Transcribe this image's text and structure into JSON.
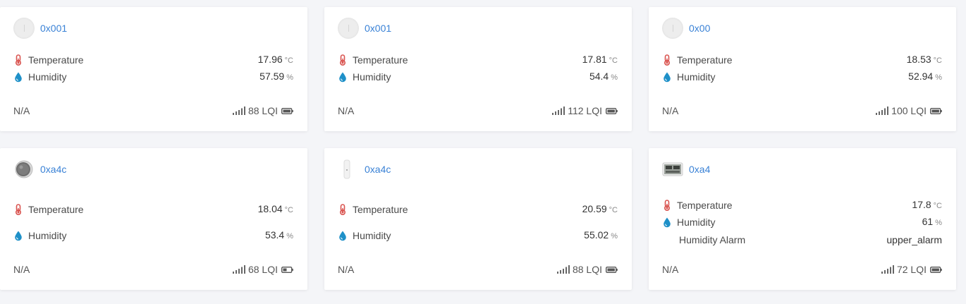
{
  "cards": [
    {
      "device_id": "0x001",
      "avatar": "blank",
      "temperature": {
        "label": "Temperature",
        "value": "17.96",
        "unit": "°C"
      },
      "humidity": {
        "label": "Humidity",
        "value": "57.59",
        "unit": "%"
      },
      "footer": {
        "status": "N/A",
        "lqi": "88 LQI"
      }
    },
    {
      "device_id": "0x001",
      "avatar": "blank",
      "temperature": {
        "label": "Temperature",
        "value": "17.81",
        "unit": "°C"
      },
      "humidity": {
        "label": "Humidity",
        "value": "54.4",
        "unit": "%"
      },
      "footer": {
        "status": "N/A",
        "lqi": "112 LQI"
      }
    },
    {
      "device_id": "0x00",
      "avatar": "blank",
      "temperature": {
        "label": "Temperature",
        "value": "18.53",
        "unit": "°C"
      },
      "humidity": {
        "label": "Humidity",
        "value": "52.94",
        "unit": "%"
      },
      "footer": {
        "status": "N/A",
        "lqi": "100 LQI"
      }
    },
    {
      "device_id": "0xa4c",
      "avatar": "round-sensor",
      "temperature": {
        "label": "Temperature",
        "value": "18.04",
        "unit": "°C"
      },
      "humidity": {
        "label": "Humidity",
        "value": "53.4",
        "unit": "%"
      },
      "footer": {
        "status": "N/A",
        "lqi": "68 LQI"
      }
    },
    {
      "device_id": "0xa4c",
      "avatar": "slim-sensor",
      "temperature": {
        "label": "Temperature",
        "value": "20.59",
        "unit": "°C"
      },
      "humidity": {
        "label": "Humidity",
        "value": "55.02",
        "unit": "%"
      },
      "footer": {
        "status": "N/A",
        "lqi": "88 LQI"
      }
    },
    {
      "device_id": "0xa4",
      "avatar": "lcd-sensor",
      "temperature": {
        "label": "Temperature",
        "value": "17.8",
        "unit": "°C"
      },
      "humidity": {
        "label": "Humidity",
        "value": "61",
        "unit": "%"
      },
      "humidity_alarm": {
        "label": "Humidity Alarm",
        "value": "upper_alarm"
      },
      "footer": {
        "status": "N/A",
        "lqi": "72 LQI"
      }
    }
  ],
  "colors": {
    "link": "#3a82d6",
    "thermometer": "#d9534f",
    "droplet": "#1e90c8",
    "background": "#f4f5f8",
    "card": "#ffffff"
  },
  "icons": {
    "temperature": "thermometer-icon",
    "humidity": "droplet-icon",
    "signal": "signal-bars-icon",
    "battery": "battery-icon"
  }
}
